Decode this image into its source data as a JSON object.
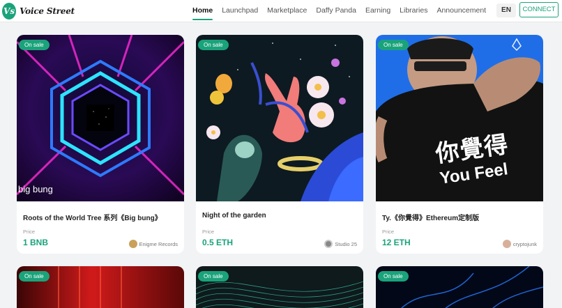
{
  "header": {
    "logo_mark": "Vs",
    "logo_text": "Voice Street",
    "nav": [
      "Home",
      "Launchpad",
      "Marketplace",
      "Daffy Panda",
      "Earning",
      "Libraries",
      "Announcement"
    ],
    "lang": "EN",
    "connect": "CONNECT"
  },
  "cards": [
    {
      "badge": "On sale",
      "name": "Roots of the World Tree 系列《Big bung》",
      "price_label": "Price",
      "price": "1 BNB",
      "creator": "Enigme Records",
      "art_caption": "big bung"
    },
    {
      "badge": "On sale",
      "name": "Night of the garden",
      "price_label": "Price",
      "price": "0.5 ETH",
      "creator": "Studio 25"
    },
    {
      "badge": "On sale",
      "name": "Ty.《你覺得》Ethereum定制版",
      "price_label": "Price",
      "price": "12 ETH",
      "creator": "cryptojunk",
      "art_text_cn": "你覺得",
      "art_text_en": "You Feel"
    },
    {
      "badge": "On sale"
    },
    {
      "badge": "On sale"
    },
    {
      "badge": "On sale"
    }
  ],
  "colors": {
    "accent": "#1aa37a",
    "background": "#f2f3f5"
  }
}
